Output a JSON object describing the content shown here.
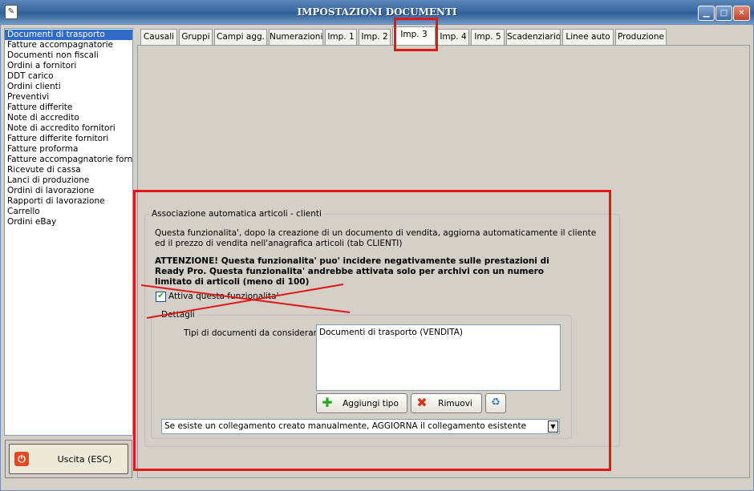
{
  "window": {
    "title": "IMPOSTAZIONI DOCUMENTI",
    "app_icon": "document-icon",
    "buttons": [
      {
        "name": "minimize-button",
        "glyph": "▁"
      },
      {
        "name": "maximize-button",
        "glyph": "□"
      },
      {
        "name": "close-button",
        "glyph": "✕"
      }
    ]
  },
  "document_types": [
    "Documenti di trasporto",
    "Fatture accompagnatorie",
    "Documenti non fiscali",
    "Ordini a fornitori",
    "DDT carico",
    "Ordini clienti",
    "Preventivi",
    "Fatture differite",
    "Note di accredito",
    "Note di accredito fornitori",
    "Fatture differite fornitori",
    "Fatture proforma",
    "Fatture accompagnatorie fornito",
    "Ricevute di cassa",
    "Lanci di produzione",
    "Ordini di lavorazione",
    "Rapporti di lavorazione",
    "Carrello",
    "Ordini eBay"
  ],
  "selected_document_type": "Documenti di trasporto",
  "exit_button": {
    "label": "Uscita (ESC)",
    "icon": "power-icon"
  },
  "tabs": [
    "Causali",
    "Gruppi",
    "Campi agg.",
    "Numerazioni",
    "Imp. 1",
    "Imp. 2",
    "Imp. 3",
    "Imp. 4",
    "Imp. 5",
    "Scadenziario",
    "Linee auto",
    "Produzione"
  ],
  "active_tab": "Imp. 3",
  "association_group": {
    "title": "Associazione automatica articoli - clienti",
    "description_line1": "Questa funzionalita', dopo la creazione di un documento di vendita, aggiorna automaticamente il cliente",
    "description_line2": "ed il prezzo di vendita nell'anagrafica articoli (tab CLIENTI)",
    "warning_line1": "ATTENZIONE! Questa funzionalita' puo' incidere negativamente sulle prestazioni di",
    "warning_line2": "Ready Pro. Questa funzionalita' andrebbe attivata solo per archivi con un numero",
    "warning_line3": "limitato di articoli (meno di 100)",
    "checkbox_label": "Attiva questa funzionalita'",
    "checkbox_checked": true
  },
  "details_group": {
    "title": "Dettagli",
    "doc_types_label": "Tipi di documenti da considerare:",
    "doc_types_values": [
      "Documenti di trasporto (VENDITA)"
    ],
    "add_button": "Aggiungi tipo",
    "remove_button": "Rimuovi",
    "extra_button_icon": "recycle-icon",
    "link_mode_value": "Se esiste un collegamento creato manualmente, AGGIORNA il collegamento esistente"
  },
  "annotation_color": "#e01818"
}
